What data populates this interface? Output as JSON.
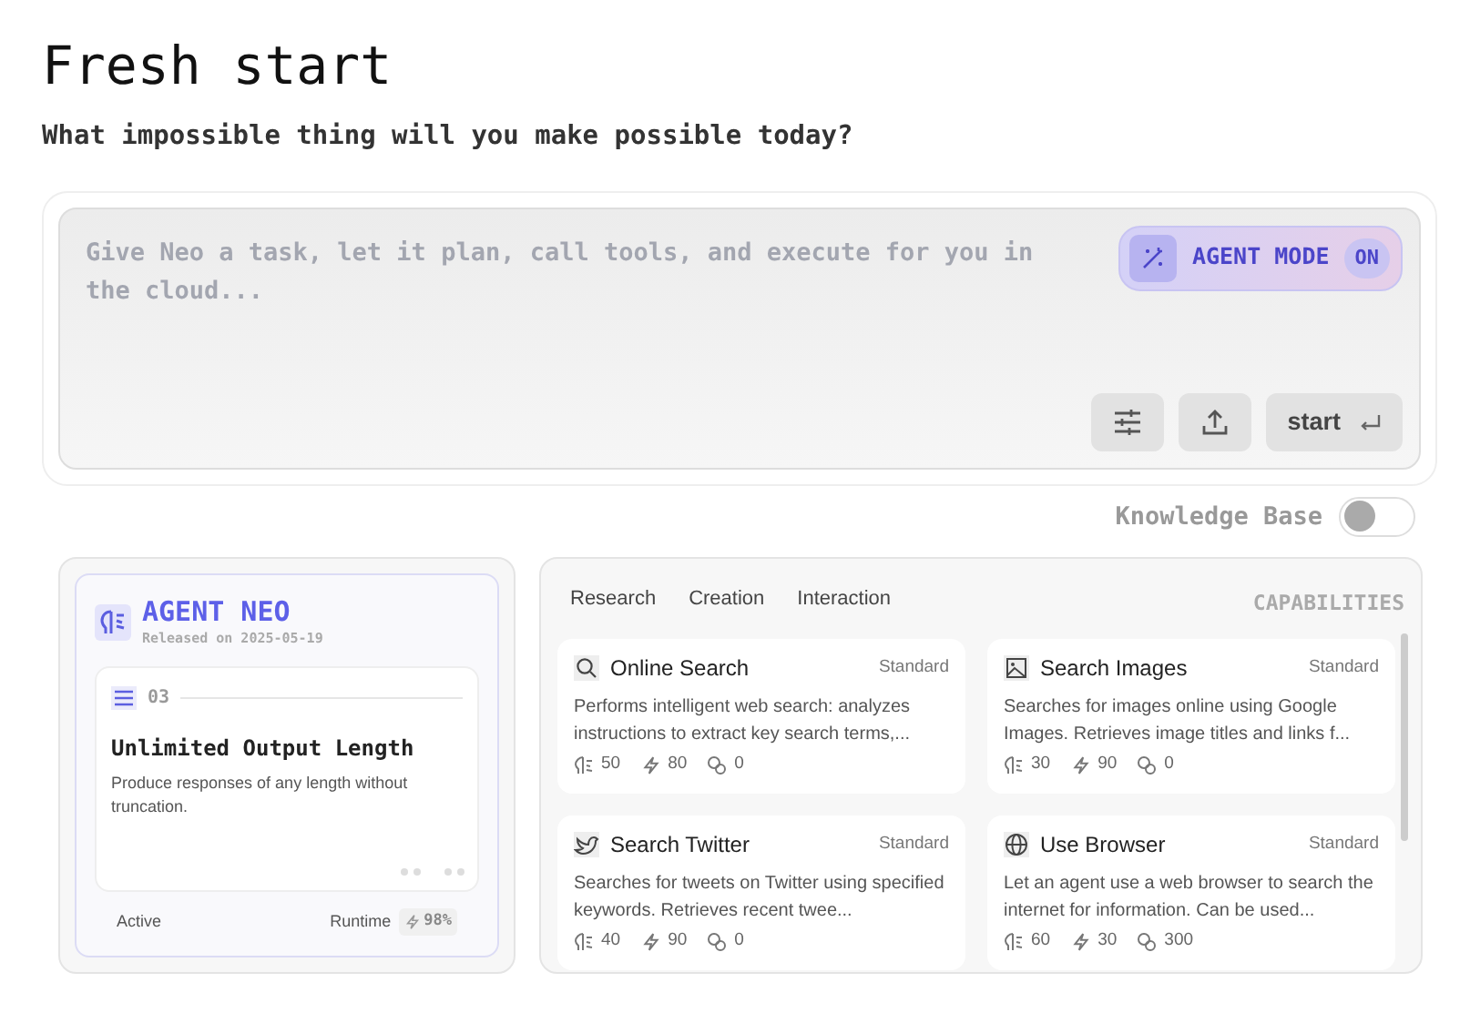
{
  "title": "Fresh start",
  "subtitle": "What impossible thing will you make possible today?",
  "prompt": {
    "placeholder": "Give Neo a task, let it plan, call tools, and execute for you in the cloud...",
    "agent_mode": {
      "label": "AGENT MODE",
      "badge": "ON",
      "on": true
    },
    "start_label": "start"
  },
  "knowledge_base": {
    "label": "Knowledge Base",
    "on": false
  },
  "agent": {
    "name": "AGENT NEO",
    "released": "Released on 2025-05-19",
    "feature": {
      "number": "03",
      "title": "Unlimited Output Length",
      "description": "Produce responses of any length without truncation."
    },
    "status": "Active",
    "runtime_label": "Runtime",
    "runtime_value": "98%"
  },
  "capabilities": {
    "heading": "CAPABILITIES",
    "tabs": [
      "Research",
      "Creation",
      "Interaction"
    ],
    "tools": [
      {
        "kind": "search",
        "name": "Online Search",
        "tier": "Standard",
        "description": "Performs intelligent web search: analyzes instructions to extract key search terms,...",
        "stats": [
          "50",
          "80",
          "0"
        ]
      },
      {
        "kind": "image",
        "name": "Search Images",
        "tier": "Standard",
        "description": "Searches for images online using Google Images. Retrieves image titles and links f...",
        "stats": [
          "30",
          "90",
          "0"
        ]
      },
      {
        "kind": "bird",
        "name": "Search Twitter",
        "tier": "Standard",
        "description": "Searches for tweets on Twitter using specified keywords. Retrieves recent twee...",
        "stats": [
          "40",
          "90",
          "0"
        ]
      },
      {
        "kind": "globe",
        "name": "Use Browser",
        "tier": "Standard",
        "description": "Let an agent use a web browser to search the internet for information. Can be used...",
        "stats": [
          "60",
          "30",
          "300"
        ]
      }
    ]
  }
}
